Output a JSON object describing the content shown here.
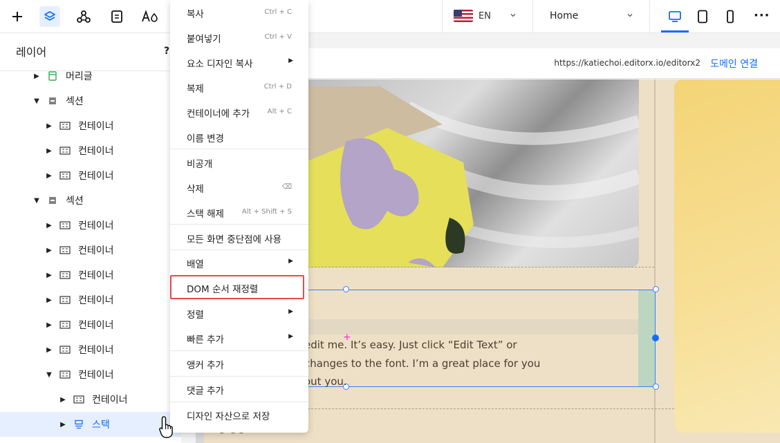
{
  "toolbar": {
    "language": "EN",
    "page": "Home"
  },
  "layers_panel": {
    "title": "레이어",
    "help": "?",
    "items": [
      {
        "label": "머리글"
      },
      {
        "label": "섹션"
      },
      {
        "label": "컨테이너"
      },
      {
        "label": "컨테이너"
      },
      {
        "label": "컨테이너"
      },
      {
        "label": "섹션"
      },
      {
        "label": "컨테이너"
      },
      {
        "label": "컨테이너"
      },
      {
        "label": "컨테이너"
      },
      {
        "label": "컨테이너"
      },
      {
        "label": "컨테이너"
      },
      {
        "label": "컨테이너"
      },
      {
        "label": "컨테이너"
      },
      {
        "label": "컨테이너"
      },
      {
        "label": "스택"
      }
    ]
  },
  "canvas": {
    "url": "https://katiechoi.editorx.io/editorx2",
    "connect_domain": "도메인 연결",
    "body_text": [
      "edit me. It’s easy. Just click “Edit Text” or",
      "changes to the font. I’m a great place for you",
      "out you."
    ],
    "partial_text": "ᄋ ᄋᄋ"
  },
  "context_menu": {
    "items": [
      {
        "label": "복사",
        "shortcut": "Ctrl + C"
      },
      {
        "label": "붙여넣기",
        "shortcut": "Ctrl + V"
      },
      {
        "label": "요소 디자인 복사"
      },
      {
        "label": "복제",
        "shortcut": "Ctrl + D"
      },
      {
        "label": "컨테이너에 추가",
        "shortcut": "Alt + C"
      },
      {
        "label": "이름 변경"
      },
      {
        "label": "비공개"
      },
      {
        "label": "삭제",
        "shortcut": "⌫"
      },
      {
        "label": "스택 해제",
        "shortcut": "Alt + Shift + S"
      },
      {
        "label": "모든 화면 중단점에 사용"
      },
      {
        "label": "배열"
      },
      {
        "label": "DOM 순서 재정렬"
      },
      {
        "label": "정렬"
      },
      {
        "label": "빠른 추가"
      },
      {
        "label": "앵커 추가"
      },
      {
        "label": "댓글 추가"
      },
      {
        "label": "디자인 자산으로 저장"
      }
    ]
  },
  "colors": {
    "accent": "#116dff",
    "highlight": "#e34b4b",
    "page_bg": "#eee0c6"
  }
}
